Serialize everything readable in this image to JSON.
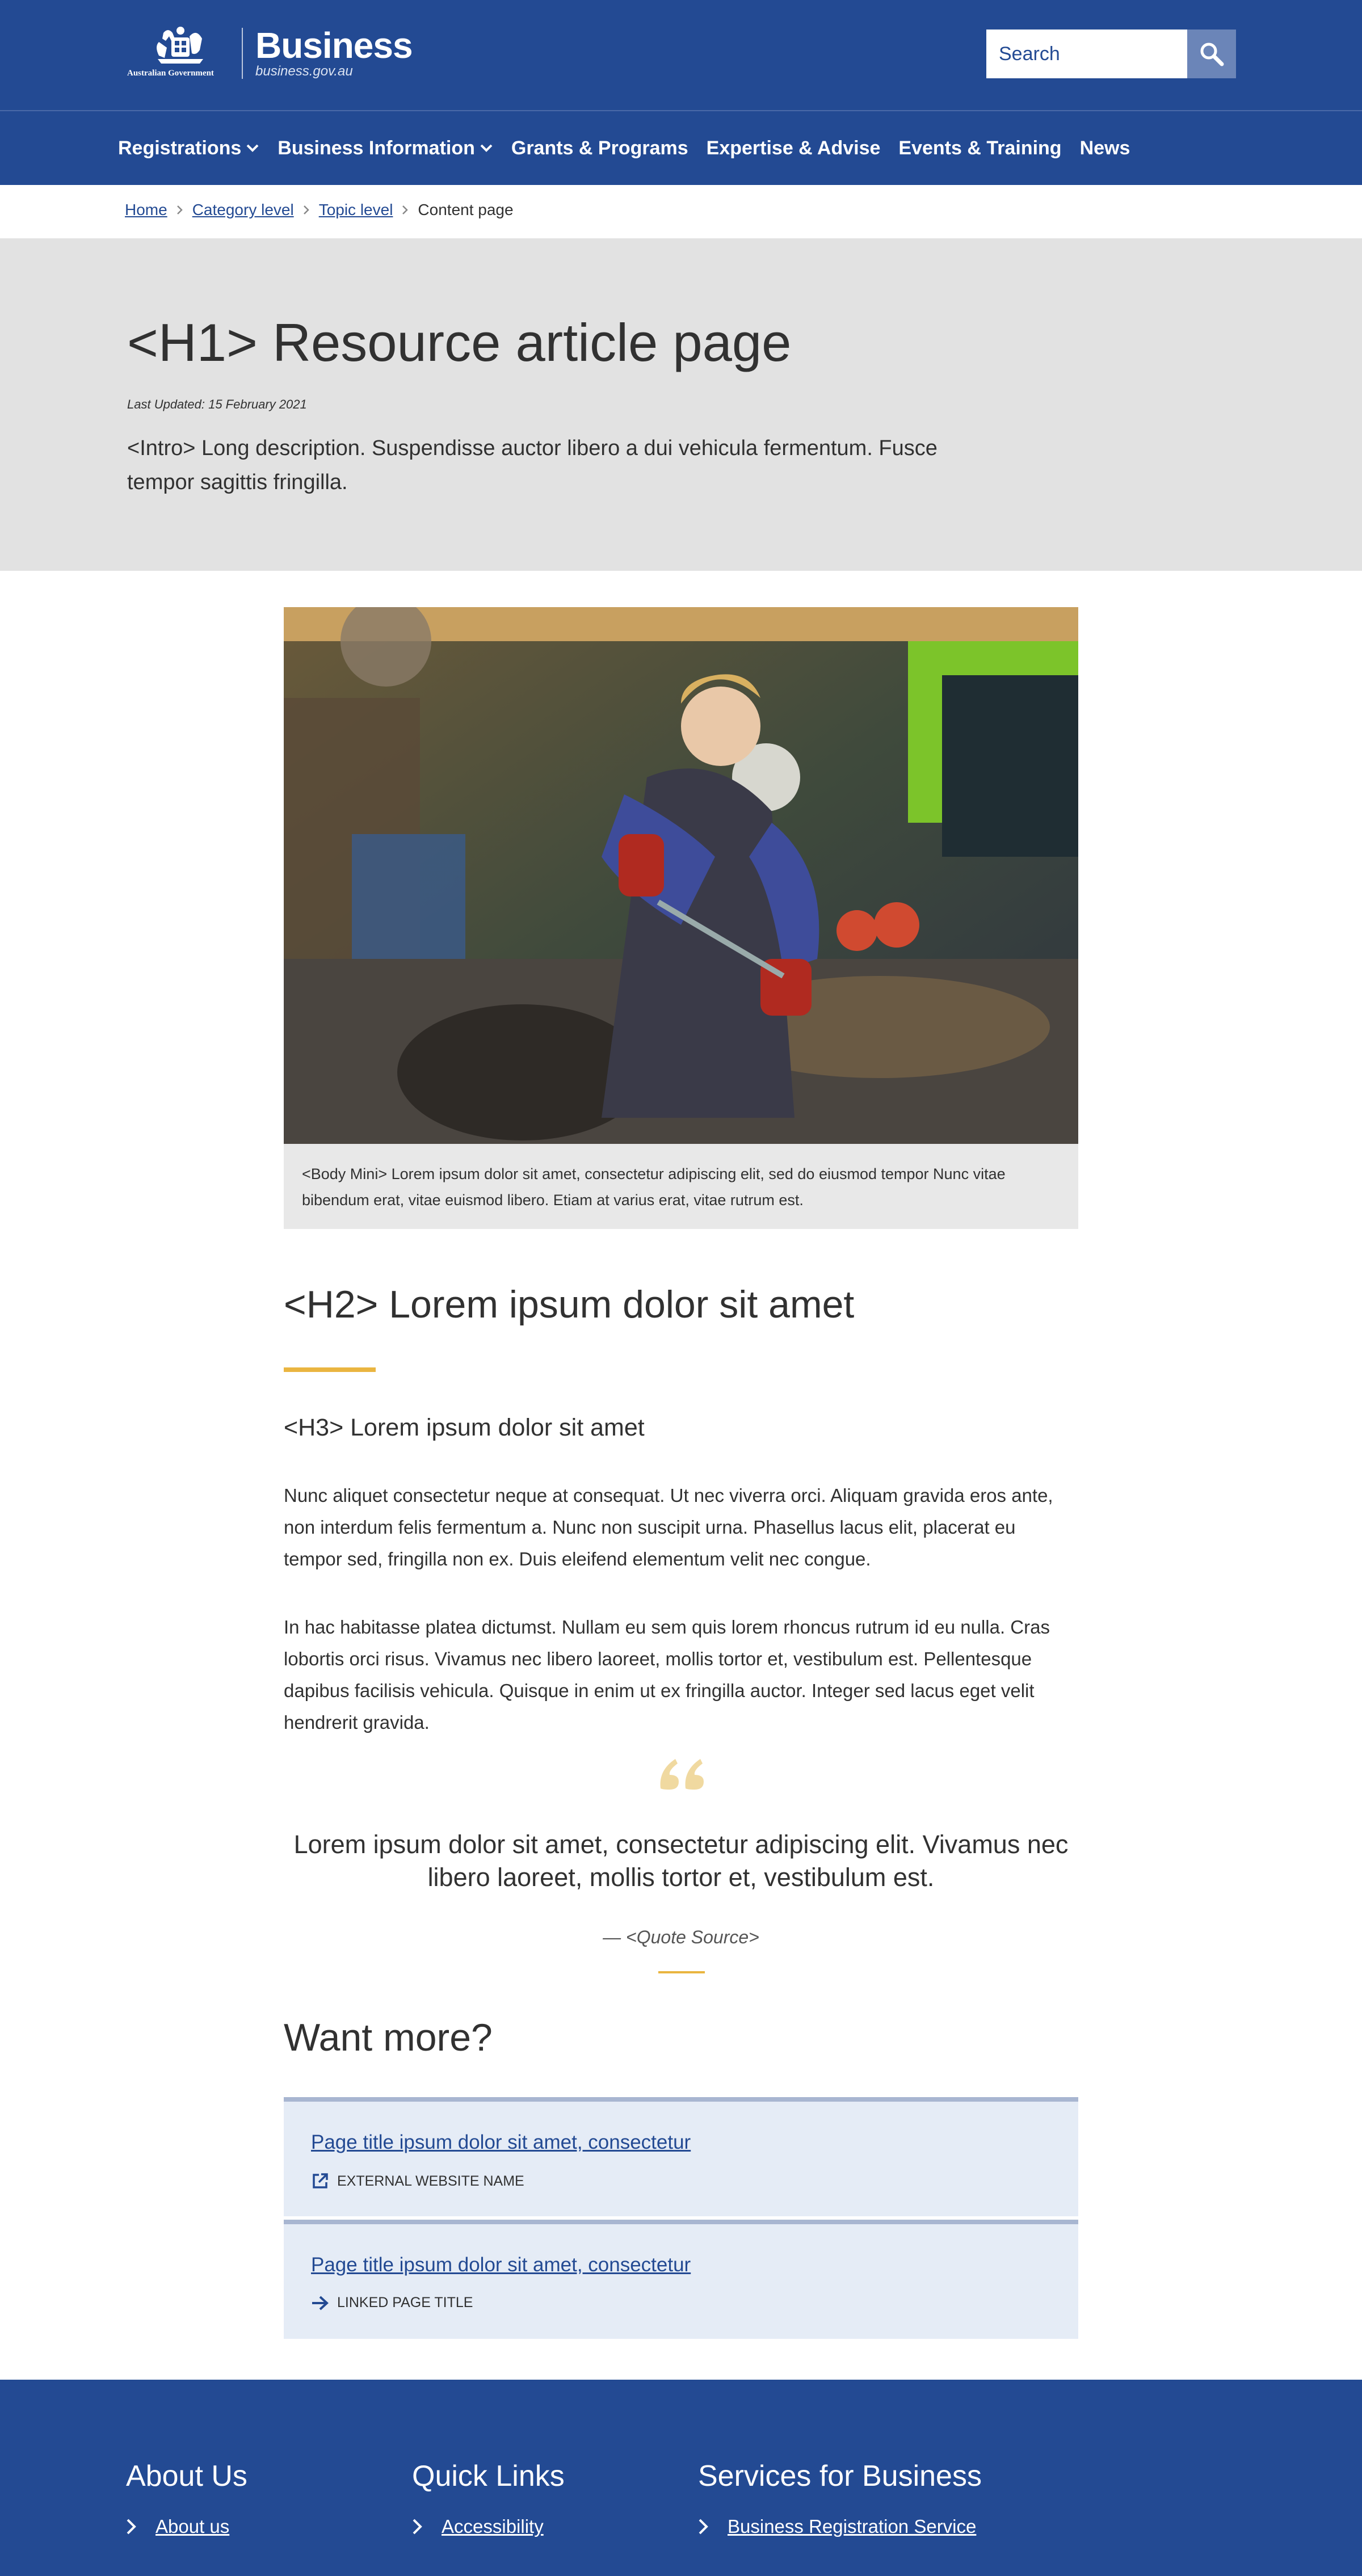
{
  "header": {
    "crest_text": "Australian Government",
    "brand_name": "Business",
    "brand_url": "business.gov.au",
    "search_placeholder": "Search"
  },
  "nav": {
    "items": [
      {
        "label": "Registrations",
        "has_dropdown": true
      },
      {
        "label": "Business Information",
        "has_dropdown": true
      },
      {
        "label": "Grants & Programs",
        "has_dropdown": false
      },
      {
        "label": "Expertise & Advise",
        "has_dropdown": false
      },
      {
        "label": "Events & Training",
        "has_dropdown": false
      },
      {
        "label": "News",
        "has_dropdown": false
      }
    ]
  },
  "breadcrumb": {
    "items": [
      "Home",
      "Category level",
      "Topic level"
    ],
    "current": "Content page"
  },
  "hero": {
    "title": "<H1> Resource article page",
    "updated": "Last Updated: 15 February 2021",
    "intro": "<Intro> Long description. Suspendisse auctor libero a dui vehicula fermentum. Fusce tempor sagittis fringilla."
  },
  "article": {
    "caption": "<Body Mini> Lorem ipsum dolor sit amet, consectetur adipiscing elit, sed do eiusmod tempor Nunc vitae bibendum erat, vitae euismod libero. Etiam at varius erat, vitae rutrum est.",
    "h2": "<H2> Lorem ipsum dolor sit amet",
    "h3": "<H3> Lorem ipsum dolor sit amet",
    "paragraphs": [
      "Nunc aliquet consectetur neque at consequat. Ut nec viverra orci. Aliquam gravida eros ante, non interdum felis fermentum a. Nunc non suscipit urna. Phasellus lacus elit, placerat eu tempor sed, fringilla non ex. Duis eleifend elementum velit nec congue.",
      "In hac habitasse platea dictumst. Nullam eu sem quis lorem rhoncus rutrum id eu nulla. Cras lobortis orci risus. Vivamus nec libero laoreet, mollis tortor et, vestibulum est. Pellentesque dapibus facilisis vehicula. Quisque in enim ut ex fringilla auctor. Integer sed lacus eget velit hendrerit gravida."
    ],
    "quote": "Lorem ipsum dolor sit amet, consectetur adipiscing elit. Vivamus nec libero laoreet, mollis tortor et, vestibulum est.",
    "quote_source": "— <Quote Source>"
  },
  "want_more": {
    "heading": "Want more?",
    "cards": [
      {
        "title": "Page title ipsum dolor sit amet, consectetur",
        "meta": "EXTERNAL WEBSITE NAME",
        "icon": "external-link-icon"
      },
      {
        "title": "Page title ipsum dolor sit amet, consectetur",
        "meta": "LINKED PAGE TITLE",
        "icon": "arrow-right-icon"
      }
    ]
  },
  "footer": {
    "columns": [
      {
        "heading": "About Us",
        "link": "About us"
      },
      {
        "heading": "Quick Links",
        "link": "Accessibility"
      },
      {
        "heading": "Services for Business",
        "link": "Business Registration Service"
      }
    ]
  },
  "colors": {
    "brand_blue": "#234a93",
    "accent_gold": "#eab540",
    "hero_grey": "#e2e2e2",
    "card_bg": "#e5ecf6"
  }
}
